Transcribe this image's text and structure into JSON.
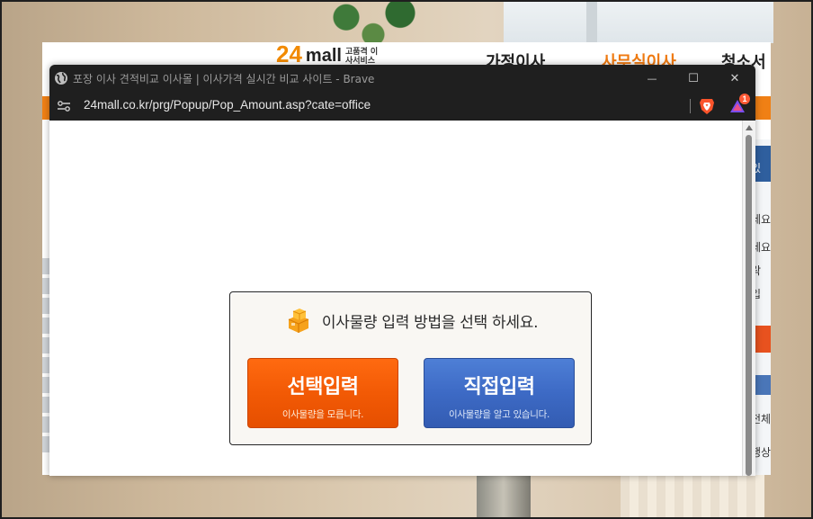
{
  "background_site": {
    "logo_number": "24",
    "logo_text": "mall",
    "logo_sub": "고품격 이사서비스",
    "nav": [
      {
        "label": "가정이사",
        "color": "#222222"
      },
      {
        "label": "사무실이사",
        "color": "#f07a10"
      },
      {
        "label": "청소서비",
        "color": "#222222"
      }
    ],
    "right_fragments": [
      "있",
      "세요",
      "세요",
      "락",
      "입",
      "전체",
      "행상"
    ]
  },
  "browser": {
    "title": "포장 이사 견적비교 이사몰 | 이사가격 실시간 비교 사이트 - Brave",
    "url": "24mall.co.kr/prg/Popup/Pop_Amount.asp?cate=office",
    "rewards_badge": "1",
    "window_controls": {
      "minimize": "—",
      "maximize": "☐",
      "close": "✕"
    }
  },
  "dialog": {
    "title": "이사물량 입력 방법을 선택 하세요.",
    "buttons": [
      {
        "label": "선택입력",
        "sub": "이사물량을 모릅니다.",
        "color": "#f25a05"
      },
      {
        "label": "직접입력",
        "sub": "이사물량을 알고 있습니다.",
        "color": "#3d6ac5"
      }
    ]
  }
}
